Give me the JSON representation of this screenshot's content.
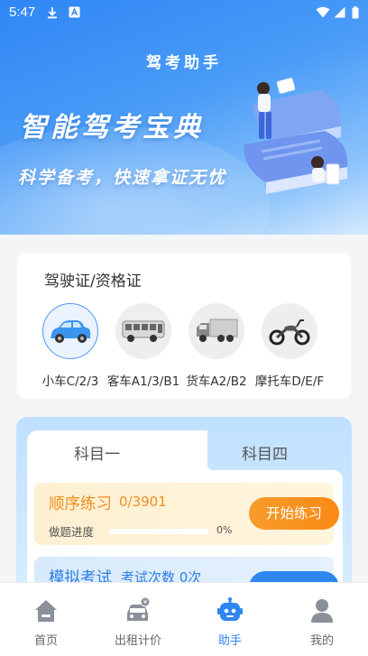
{
  "status_bar": {
    "time": "5:47"
  },
  "hero": {
    "title": "驾考助手",
    "headline": "智能驾考宝典",
    "subheadline": "科学备考，快速拿证无忧"
  },
  "license": {
    "title": "驾驶证/资格证",
    "vehicles": [
      {
        "label": "小车C/2/3",
        "icon": "car-icon",
        "selected": true
      },
      {
        "label": "客车A1/3/B1",
        "icon": "bus-icon",
        "selected": false
      },
      {
        "label": "货车A2/B2",
        "icon": "truck-icon",
        "selected": false
      },
      {
        "label": "摩托车D/E/F",
        "icon": "motorcycle-icon",
        "selected": false
      }
    ]
  },
  "subjects": {
    "tabs": [
      {
        "label": "科目一",
        "active": true
      },
      {
        "label": "科目四",
        "active": false
      }
    ],
    "practice": {
      "title": "顺序练习",
      "count": "0/3901",
      "progress_label": "做题进度",
      "progress_percent": "0%",
      "progress_value": 0,
      "button": "开始练习"
    },
    "mock": {
      "title": "模拟考试",
      "count": "考试次数 0次"
    }
  },
  "bottom_nav": [
    {
      "label": "首页",
      "icon": "home-icon",
      "active": false
    },
    {
      "label": "出租计价",
      "icon": "taxi-meter-icon",
      "active": false
    },
    {
      "label": "助手",
      "icon": "robot-icon",
      "active": true
    },
    {
      "label": "我的",
      "icon": "user-icon",
      "active": false
    }
  ],
  "colors": {
    "accent_blue": "#2f86f0",
    "accent_orange": "#f28c1f",
    "hero_blue": "#2f86f5"
  }
}
